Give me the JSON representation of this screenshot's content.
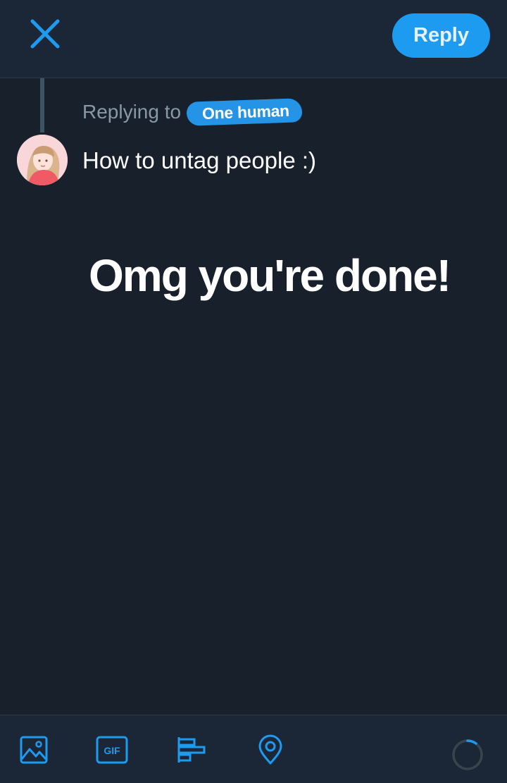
{
  "header": {
    "close_icon": "close-icon",
    "reply_label": "Reply"
  },
  "thread": {
    "replying_to_label": "Replying to",
    "mention": "One human"
  },
  "compose": {
    "text": "How to untag people :)"
  },
  "overlay": {
    "caption": "Omg you're done!"
  },
  "toolbar": {
    "icons": [
      "image-icon",
      "gif-icon",
      "poll-icon",
      "location-icon"
    ],
    "gif_label": "GIF"
  },
  "colors": {
    "background": "#18202b",
    "bar": "#1b2736",
    "accent": "#1d9bf0",
    "secondary_text": "#8899a6"
  }
}
